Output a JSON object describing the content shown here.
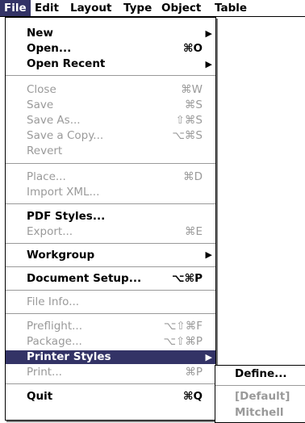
{
  "menubar": {
    "items": [
      "File",
      "Edit",
      "Layout",
      "Type",
      "Object",
      "Table"
    ]
  },
  "menu": {
    "items": [
      {
        "label": "New",
        "shortcut": "",
        "submenu_arrow": "▶",
        "enabled": true
      },
      {
        "label": "Open...",
        "shortcut": "⌘O",
        "enabled": true
      },
      {
        "label": "Open Recent",
        "shortcut": "",
        "submenu_arrow": "▶",
        "enabled": true
      },
      {
        "label": "Close",
        "shortcut": "⌘W",
        "enabled": false
      },
      {
        "label": "Save",
        "shortcut": "⌘S",
        "enabled": false
      },
      {
        "label": "Save As...",
        "shortcut": "⇧⌘S",
        "enabled": false
      },
      {
        "label": "Save a Copy...",
        "shortcut": "⌥⌘S",
        "enabled": false
      },
      {
        "label": "Revert",
        "shortcut": "",
        "enabled": false
      },
      {
        "label": "Place...",
        "shortcut": "⌘D",
        "enabled": false
      },
      {
        "label": "Import XML...",
        "shortcut": "",
        "enabled": false
      },
      {
        "label": "PDF Styles...",
        "shortcut": "",
        "enabled": true
      },
      {
        "label": "Export...",
        "shortcut": "⌘E",
        "enabled": false
      },
      {
        "label": "Workgroup",
        "shortcut": "",
        "submenu_arrow": "▶",
        "enabled": true
      },
      {
        "label": "Document Setup...",
        "shortcut": "⌥⌘P",
        "enabled": true
      },
      {
        "label": "File Info...",
        "shortcut": "",
        "enabled": false
      },
      {
        "label": "Preflight...",
        "shortcut": "⌥⇧⌘F",
        "enabled": false
      },
      {
        "label": "Package...",
        "shortcut": "⌥⇧⌘P",
        "enabled": false
      },
      {
        "label": "Printer Styles",
        "shortcut": "",
        "submenu_arrow": "▶",
        "enabled": true,
        "highlighted": true
      },
      {
        "label": "Print...",
        "shortcut": "⌘P",
        "enabled": false
      },
      {
        "label": "Quit",
        "shortcut": "⌘Q",
        "enabled": true
      }
    ]
  },
  "submenu": {
    "items": [
      {
        "label": "Define...",
        "enabled": true
      },
      {
        "label": "[Default]",
        "enabled": false
      },
      {
        "label": "Mitchell",
        "enabled": false
      }
    ]
  },
  "colors": {
    "highlight": "#333366",
    "disabled_text": "#9a9a9a"
  }
}
